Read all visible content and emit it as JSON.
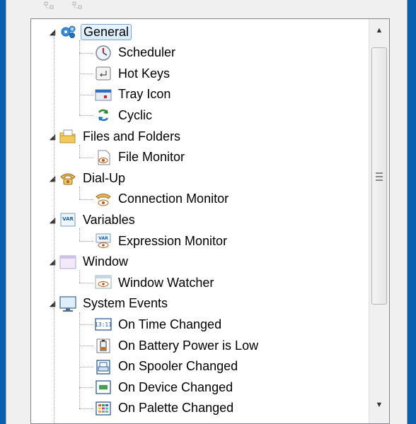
{
  "tree": {
    "groups": [
      {
        "label": "General",
        "icon": "gears-icon",
        "children": [
          {
            "label": "Scheduler",
            "icon": "clock-icon"
          },
          {
            "label": "Hot Keys",
            "icon": "keyboard-key-icon"
          },
          {
            "label": "Tray Icon",
            "icon": "tray-icon"
          },
          {
            "label": "Cyclic",
            "icon": "cycle-arrows-icon"
          }
        ]
      },
      {
        "label": "Files and Folders",
        "icon": "folder-icon",
        "children": [
          {
            "label": "File Monitor",
            "icon": "file-eye-icon"
          }
        ]
      },
      {
        "label": "Dial-Up",
        "icon": "telephone-icon",
        "children": [
          {
            "label": "Connection Monitor",
            "icon": "telephone-eye-icon"
          }
        ]
      },
      {
        "label": "Variables",
        "icon": "var-icon",
        "children": [
          {
            "label": "Expression Monitor",
            "icon": "var-eye-icon"
          }
        ]
      },
      {
        "label": "Window",
        "icon": "window-icon",
        "children": [
          {
            "label": "Window Watcher",
            "icon": "window-eye-icon"
          }
        ]
      },
      {
        "label": "System Events",
        "icon": "monitor-icon",
        "children": [
          {
            "label": "On Time Changed",
            "icon": "time-icon"
          },
          {
            "label": "On Battery Power is Low",
            "icon": "battery-icon"
          },
          {
            "label": "On Spooler Changed",
            "icon": "printer-icon"
          },
          {
            "label": "On Device Changed",
            "icon": "device-chip-icon"
          },
          {
            "label": "On Palette Changed",
            "icon": "palette-icon"
          }
        ]
      }
    ],
    "selected": "General"
  },
  "colors": {
    "selection_border": "#7da2ce",
    "window_frame": "#0b5fb0"
  }
}
